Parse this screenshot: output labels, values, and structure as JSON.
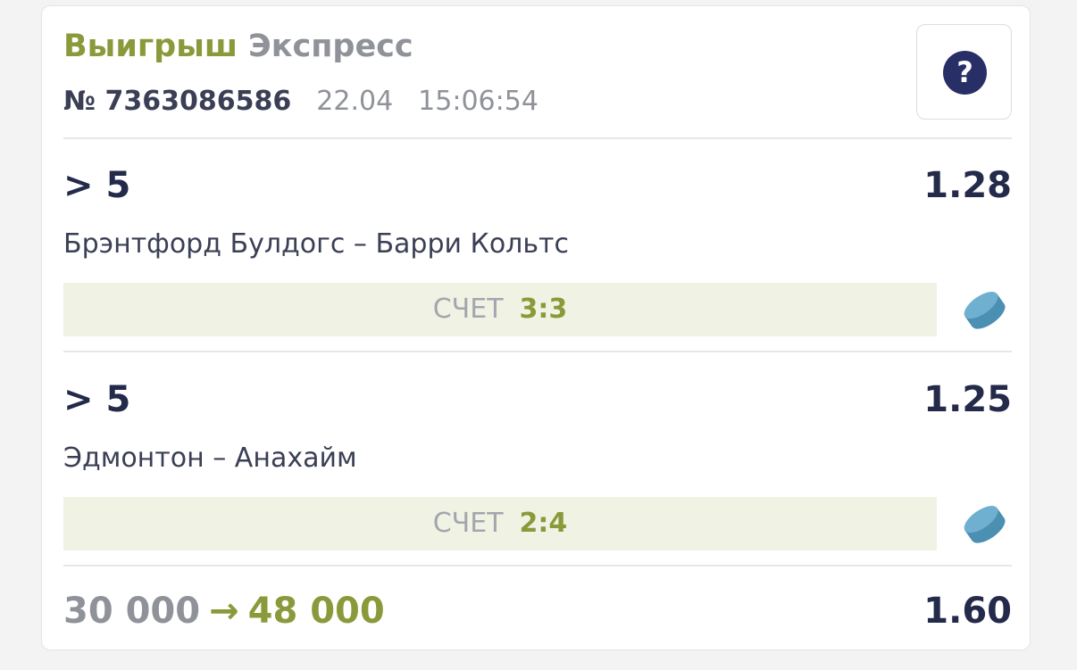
{
  "header": {
    "status": "Выигрыш",
    "bet_type": "Экспресс",
    "number": "№ 7363086586",
    "date": "22.04",
    "time": "15:06:54",
    "help_symbol": "?"
  },
  "bets": [
    {
      "selection": "> 5",
      "coef": "1.28",
      "match": "Брэнтфорд Булдогс – Барри Кольтс",
      "score_label": "СЧЕТ",
      "score": "3:3",
      "sport_icon": "hockey-puck-icon"
    },
    {
      "selection": "> 5",
      "coef": "1.25",
      "match": "Эдмонтон – Анахайм",
      "score_label": "СЧЕТ",
      "score": "2:4",
      "sport_icon": "hockey-puck-icon"
    }
  ],
  "footer": {
    "stake": "30 000",
    "arrow": "→",
    "payout": "48 000",
    "total_coef": "1.60"
  },
  "colors": {
    "win_green": "#8a9a3a",
    "navy": "#242a4a",
    "gray": "#8f9299",
    "score_bg": "#f0f2e4",
    "puck": "#5fa3c4"
  }
}
